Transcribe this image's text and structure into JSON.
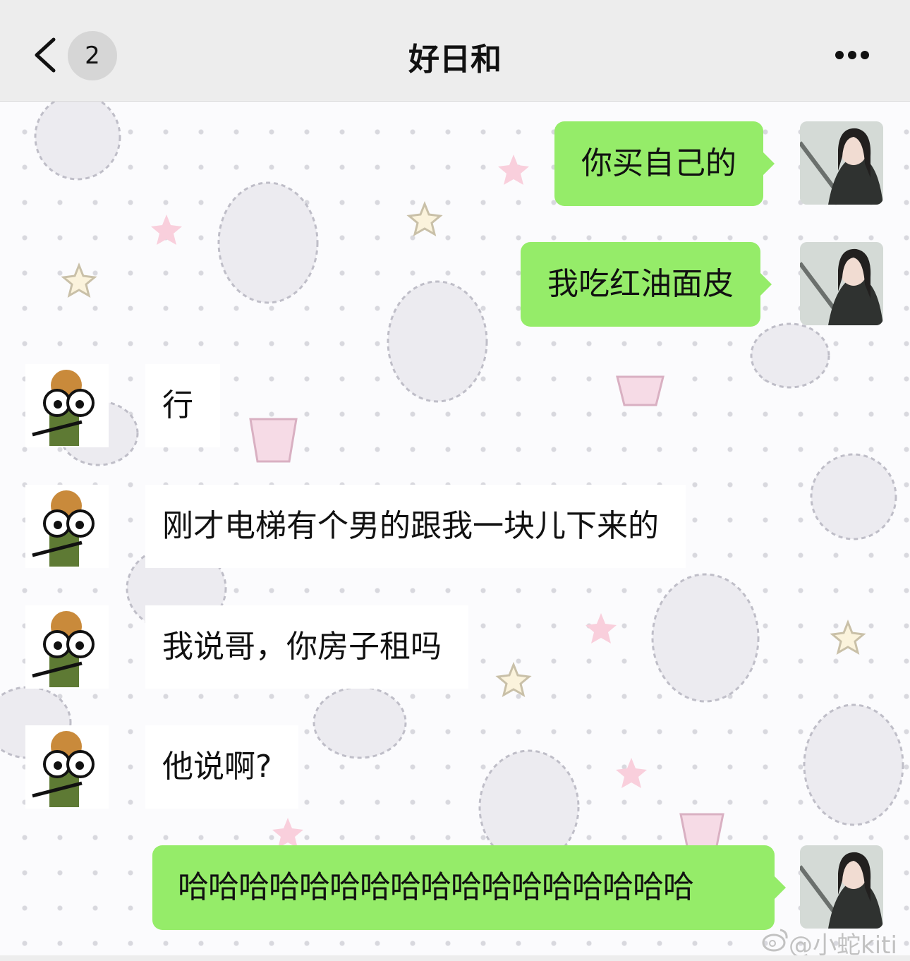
{
  "header": {
    "unread_count": "2",
    "title": "好日和"
  },
  "messages": [
    {
      "side": "right",
      "text": "你买自己的"
    },
    {
      "side": "right",
      "text": "我吃红油面皮"
    },
    {
      "side": "left",
      "text": "行"
    },
    {
      "side": "left",
      "text": "刚才电梯有个男的跟我一块儿下来的"
    },
    {
      "side": "left",
      "text": "我说哥，你房子租吗"
    },
    {
      "side": "left",
      "text": "他说啊?"
    },
    {
      "side": "right",
      "text": "哈哈哈哈哈哈哈哈哈哈哈哈哈哈哈哈哈"
    }
  ],
  "watermark": "@小蛇kiti",
  "colors": {
    "header_bg": "#ededed",
    "my_bubble": "#95ec69",
    "their_bubble": "#ffffff"
  },
  "icons": [
    "back-chevron-icon",
    "more-dots-icon",
    "weibo-icon"
  ]
}
